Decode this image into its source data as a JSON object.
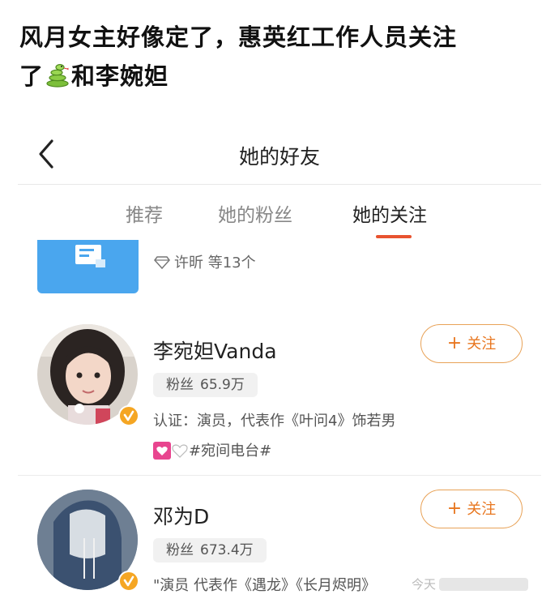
{
  "caption": {
    "line1": "风月女主好像定了，惠英红工作人员关注",
    "line2_prefix": "了",
    "line2_suffix": "和李婉妲",
    "emoji": "snake-emoji"
  },
  "navbar": {
    "title": "她的好友",
    "back_icon": "chevron-left-icon"
  },
  "tabs": [
    {
      "label": "推荐",
      "active": false
    },
    {
      "label": "她的粉丝",
      "active": false
    },
    {
      "label": "她的关注",
      "active": true
    }
  ],
  "colors": {
    "accent": "#e8532f",
    "follow_border": "#e8a257",
    "follow_text": "#e8761f",
    "verified": "#f5a623",
    "group_icon": "#4aa6ee"
  },
  "group": {
    "members_text": "许昕 等13个",
    "icon": "diamond-icon"
  },
  "users": [
    {
      "name": "李宛妲Vanda",
      "fans_label": "粉丝",
      "fans_count": "65.9万",
      "desc": "认证：演员，代表作《叶问4》饰若男",
      "tag": "#宛间电台#",
      "follow_label": "关注"
    },
    {
      "name": "邓为D",
      "fans_label": "粉丝",
      "fans_count": "673.4万",
      "desc": "\"演员 代表作《遇龙》《长月烬明》",
      "follow_label": "关注"
    }
  ],
  "watermark": {
    "text": "今天"
  }
}
